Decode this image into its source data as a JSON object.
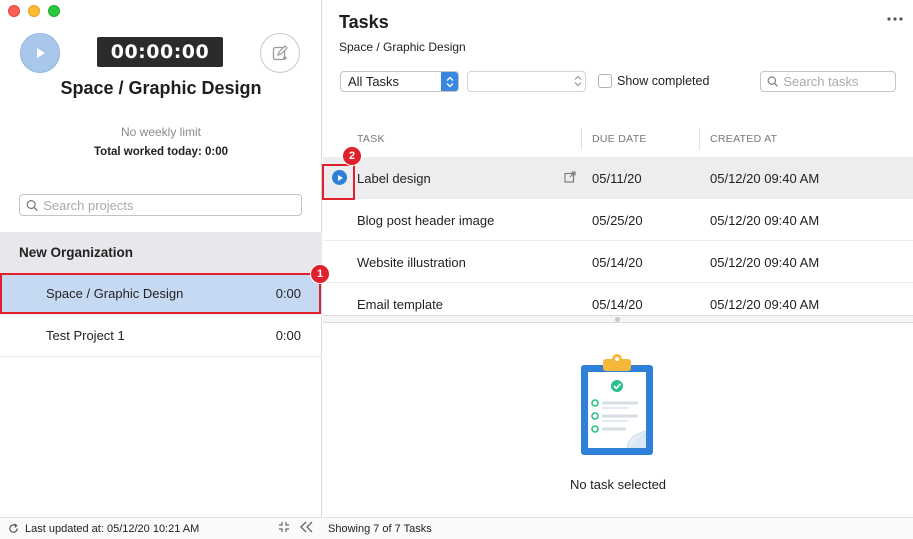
{
  "timer": {
    "value": "00:00:00"
  },
  "project": {
    "title": "Space / Graphic Design",
    "weekly_limit": "No weekly limit",
    "total_worked": "Total worked today:  0:00"
  },
  "project_search": {
    "placeholder": "Search projects"
  },
  "sidebar": {
    "organization": "New Organization",
    "projects": [
      {
        "name": "Space / Graphic Design",
        "time": "0:00",
        "selected": true
      },
      {
        "name": "Test Project 1",
        "time": "0:00",
        "selected": false
      }
    ]
  },
  "left_footer": {
    "last_updated": "Last updated at: 05/12/20 10:21 AM"
  },
  "tasks_panel": {
    "title": "Tasks",
    "subtitle": "Space / Graphic Design",
    "filter": {
      "selected": "All Tasks",
      "secondary_value": ""
    },
    "show_completed_label": "Show completed",
    "show_completed_checked": false,
    "search_placeholder": "Search tasks",
    "columns": {
      "task": "TASK",
      "due_date": "DUE DATE",
      "created_at": "CREATED AT"
    },
    "rows": [
      {
        "task": "Label design",
        "due": "05/11/20",
        "created": "05/12/20 09:40 AM",
        "selected": true
      },
      {
        "task": "Blog post header image",
        "due": "05/25/20",
        "created": "05/12/20 09:40 AM",
        "selected": false
      },
      {
        "task": "Website illustration",
        "due": "05/14/20",
        "created": "05/12/20 09:40 AM",
        "selected": false
      },
      {
        "task": "Email template",
        "due": "05/14/20",
        "created": "05/12/20 09:40 AM",
        "selected": false
      }
    ],
    "empty_state": "No task selected",
    "footer": "Showing 7 of 7 Tasks"
  },
  "annotations": {
    "badge_1": "1",
    "badge_2": "2",
    "highlight_color": "#e0202a"
  },
  "colors": {
    "accent": "#2f80d8",
    "selected_project": "#c5daf2",
    "timer_bg": "#2b2b2b"
  },
  "icons": [
    "play-icon",
    "edit-icon",
    "search-icon",
    "refresh-icon",
    "compress-icon",
    "collapse-icon",
    "more-icon",
    "open-external-icon",
    "clipboard-icon"
  ]
}
